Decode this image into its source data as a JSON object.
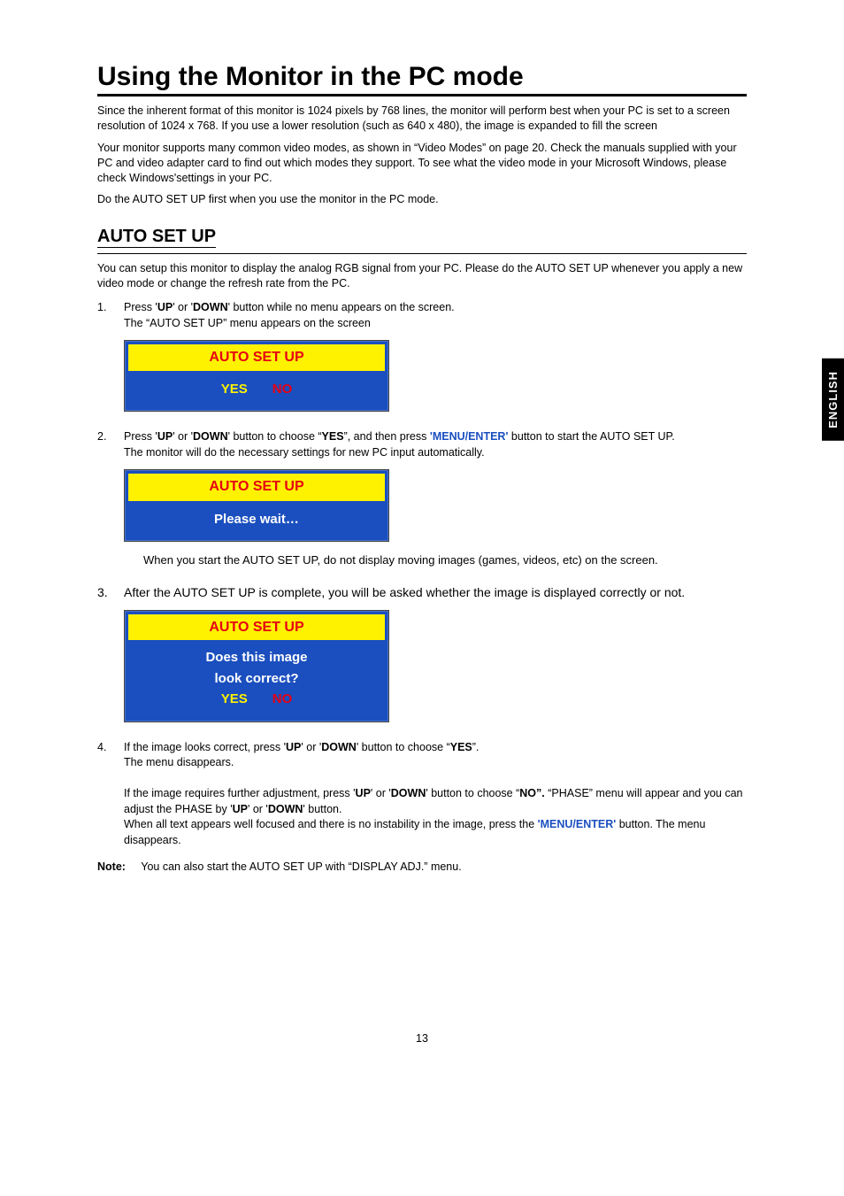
{
  "side_tab": "ENGLISH",
  "title": "Using the Monitor in the PC mode",
  "intro": {
    "p1": "Since the inherent format of this monitor is 1024 pixels by 768 lines, the monitor will perform best when your PC is set to a screen resolution of 1024 x 768. If you use a lower resolution (such as 640 x 480), the image is expanded to fill the screen",
    "p2": "Your monitor supports many common video modes, as shown in “Video Modes” on page 20. Check the manuals supplied with your PC and video adapter card to find out which modes they support. To see what the video mode in your Microsoft Windows, please check Windows'settings in your PC.",
    "p3": "Do the AUTO SET UP first when you use the monitor in the PC mode."
  },
  "section_heading": "AUTO SET UP",
  "section_intro": "You can setup this monitor to display the analog RGB signal from your PC. Please do the AUTO SET UP whenever you apply a new video mode or change the refresh rate from the PC.",
  "steps": {
    "s1": {
      "num": "1.",
      "line1_a": "Press '",
      "line1_up": "UP",
      "line1_b": "' or '",
      "line1_down": "DOWN",
      "line1_c": "' button while no menu appears on the screen.",
      "line2": "The “AUTO SET UP” menu appears on the screen"
    },
    "s2": {
      "num": "2.",
      "line1_a": "Press '",
      "line1_up": "UP",
      "line1_b": "' or '",
      "line1_down": "DOWN",
      "line1_c": "' button to choose “",
      "line1_yes": "YES",
      "line1_d": "”, and then press ",
      "line1_menu": "'MENU/ENTER'",
      "line1_e": " button to start the AUTO SET UP.",
      "line2": "The monitor will do the necessary settings for new PC input automatically."
    },
    "s2_note": "When you start the AUTO SET UP, do not display moving images (games, videos, etc) on the screen.",
    "s3": {
      "num": "3.",
      "text": "After the AUTO SET UP is complete, you will be asked whether the image is displayed correctly or not."
    },
    "s4": {
      "num": "4.",
      "l1_a": "If the image looks correct, press '",
      "l1_up": "UP",
      "l1_b": "' or '",
      "l1_down": "DOWN",
      "l1_c": "' button to choose “",
      "l1_yes": "YES",
      "l1_d": "”.",
      "l2": "The menu disappears.",
      "l3_a": "If the image requires further adjustment, press '",
      "l3_up": "UP",
      "l3_b": "' or '",
      "l3_down": "DOWN",
      "l3_c": "' button to choose “",
      "l3_no": "NO”.",
      "l3_d": " “PHASE” menu will appear and you can adjust the PHASE by '",
      "l3_up2": "UP",
      "l3_e": "' or '",
      "l3_down2": "DOWN",
      "l3_f": "' button.",
      "l4_a": "When all text appears well focused and there is no instability in the image, press the ",
      "l4_menu": "'MENU/ENTER'",
      "l4_b": " button. The menu disappears."
    }
  },
  "osd": {
    "title": "AUTO SET UP",
    "yes": "YES",
    "no": "NO",
    "wait": "Please wait…",
    "prompt1": "Does this image",
    "prompt2": "look correct?"
  },
  "note": {
    "label": "Note:",
    "text": "You can also start the AUTO SET UP with “DISPLAY ADJ.” menu."
  },
  "page_number": "13"
}
